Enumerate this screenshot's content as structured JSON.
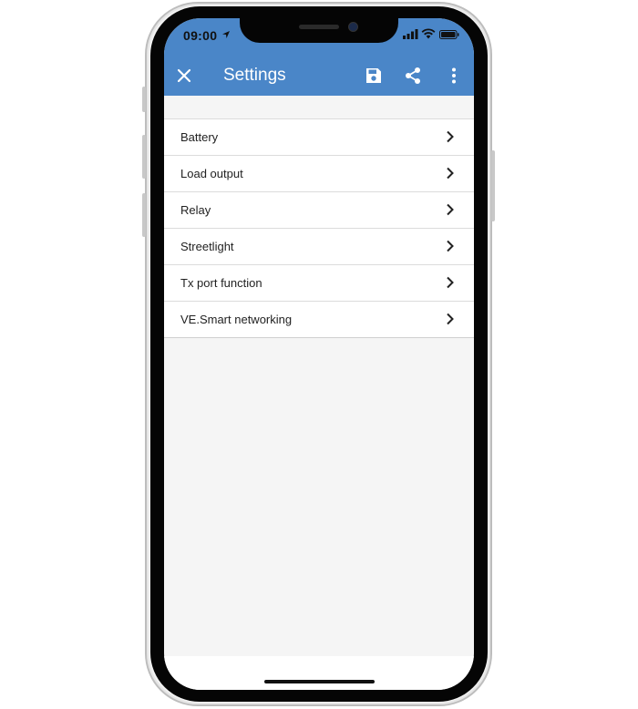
{
  "status_bar": {
    "time": "09:00"
  },
  "app_bar": {
    "title": "Settings",
    "color": "#4a86c8",
    "icons": [
      "close-icon",
      "save-icon",
      "share-icon",
      "more-vert-icon"
    ]
  },
  "settings": {
    "items": [
      {
        "label": "Battery"
      },
      {
        "label": "Load output"
      },
      {
        "label": "Relay"
      },
      {
        "label": "Streetlight"
      },
      {
        "label": "Tx port function"
      },
      {
        "label": "VE.Smart networking"
      }
    ]
  }
}
